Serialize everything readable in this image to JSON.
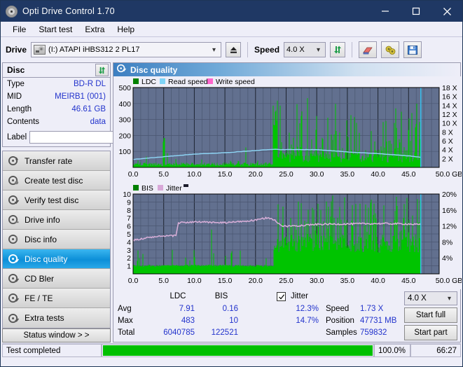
{
  "window": {
    "title": "Opti Drive Control 1.70",
    "icon": "disc-icon",
    "minimize": "minimize-icon",
    "maximize": "maximize-icon",
    "close": "close-icon"
  },
  "menu": {
    "items": [
      "File",
      "Start test",
      "Extra",
      "Help"
    ]
  },
  "toolbar": {
    "drive_label": "Drive",
    "drive_value": "(I:)   ATAPI iHBS312   2 PL17",
    "eject_icon": "eject-icon",
    "speed_label": "Speed",
    "speed_value": "4.0 X",
    "refresh_icon": "refresh-icon",
    "erase_icon": "erase-icon",
    "tools_icon": "tools-icon",
    "save_icon": "save-icon"
  },
  "disc": {
    "header": "Disc",
    "refresh_icon": "refresh-icon",
    "rows": [
      {
        "key": "Type",
        "value": "BD-R DL"
      },
      {
        "key": "MID",
        "value": "MEIRB1 (001)"
      },
      {
        "key": "Length",
        "value": "46.61 GB"
      },
      {
        "key": "Contents",
        "value": "data"
      }
    ],
    "label_key": "Label",
    "label_value": "",
    "label_btn_icon": "disc-label-icon"
  },
  "nav": {
    "items": [
      {
        "label": "Transfer rate",
        "icon": "disc-test-icon",
        "active": false
      },
      {
        "label": "Create test disc",
        "icon": "disc-create-icon",
        "active": false
      },
      {
        "label": "Verify test disc",
        "icon": "disc-verify-icon",
        "active": false
      },
      {
        "label": "Drive info",
        "icon": "drive-info-icon",
        "active": false
      },
      {
        "label": "Disc info",
        "icon": "disc-info-icon",
        "active": false
      },
      {
        "label": "Disc quality",
        "icon": "disc-quality-icon",
        "active": true
      },
      {
        "label": "CD Bler",
        "icon": "cd-bler-icon",
        "active": false
      },
      {
        "label": "FE / TE",
        "icon": "fe-te-icon",
        "active": false
      },
      {
        "label": "Extra tests",
        "icon": "extra-tests-icon",
        "active": false
      }
    ],
    "status_button": "Status window > >"
  },
  "main": {
    "title": "Disc quality",
    "title_icon": "disc-quality-icon"
  },
  "stats": {
    "col_ldc": "LDC",
    "col_bis": "BIS",
    "jitter_label": "Jitter",
    "jitter_checked": true,
    "rows": [
      {
        "label": "Avg",
        "ldc": "7.91",
        "bis": "0.16",
        "jitter": "12.3%"
      },
      {
        "label": "Max",
        "ldc": "483",
        "bis": "10",
        "jitter": "14.7%"
      },
      {
        "label": "Total",
        "ldc": "6040785",
        "bis": "122521",
        "jitter": ""
      }
    ],
    "speed_label": "Speed",
    "speed_value": "1.73 X",
    "position_label": "Position",
    "position_value": "47731 MB",
    "samples_label": "Samples",
    "samples_value": "759832",
    "speed_select": "4.0 X",
    "start_full": "Start full",
    "start_part": "Start part"
  },
  "statusbar": {
    "text": "Test completed",
    "percent_label": "100.0%",
    "percent": 100,
    "time": "66:27",
    "bar_color": "#00c000"
  },
  "chart_data": [
    {
      "type": "area",
      "name": "ldc-chart",
      "title": "",
      "xlabel": "GB",
      "ylabel": "",
      "xlim": [
        0,
        50
      ],
      "xticks": [
        "0.0",
        "5.0",
        "10.0",
        "15.0",
        "20.0",
        "25.0",
        "30.0",
        "35.0",
        "40.0",
        "45.0",
        "50.0 GB"
      ],
      "ylim": [
        0,
        500
      ],
      "yticks": [
        "100",
        "200",
        "300",
        "400",
        "500"
      ],
      "y2lim": [
        0,
        18
      ],
      "y2ticks": [
        "2 X",
        "4 X",
        "6 X",
        "8 X",
        "10 X",
        "12 X",
        "14 X",
        "16 X",
        "18 X"
      ],
      "grid": true,
      "plot_bg": "#62708f",
      "legend": [
        {
          "label": "LDC",
          "color": "#008000"
        },
        {
          "label": "Read speed",
          "color": "#7fd4f7"
        },
        {
          "label": "Write speed",
          "color": "#ff66cc"
        }
      ],
      "series": [
        {
          "name": "LDC",
          "color": "#00c000",
          "type": "bars",
          "note": "error counts per position; dense green spikes over 0-47 GB, baseline ~10-40, tall spikes to 200-480 after 23 GB",
          "x_end": 47.0
        },
        {
          "name": "Read speed",
          "color": "#8fd8f8",
          "type": "line",
          "note": "rises from ~1.8X at 0 GB to ~4.1X near 23 GB, flat ~4.1X to 30 GB, declines to ~2.3X at 47 GB",
          "points": [
            [
              0,
              1.8
            ],
            [
              5,
              2.4
            ],
            [
              10,
              3.0
            ],
            [
              15,
              3.3
            ],
            [
              20,
              3.8
            ],
            [
              23,
              4.1
            ],
            [
              24,
              4.0
            ],
            [
              30,
              4.0
            ],
            [
              35,
              3.5
            ],
            [
              40,
              3.1
            ],
            [
              45,
              2.6
            ],
            [
              47,
              2.3
            ]
          ]
        }
      ],
      "cursor_x": 47.0,
      "cursor_color": "#35c6f4"
    },
    {
      "type": "area",
      "name": "bis-jitter-chart",
      "title": "",
      "xlabel": "GB",
      "ylabel": "",
      "xlim": [
        0,
        50
      ],
      "xticks": [
        "0.0",
        "5.0",
        "10.0",
        "15.0",
        "20.0",
        "25.0",
        "30.0",
        "35.0",
        "40.0",
        "45.0",
        "50.0 GB"
      ],
      "ylim": [
        0,
        10
      ],
      "yticks": [
        "1",
        "2",
        "3",
        "4",
        "5",
        "6",
        "7",
        "8",
        "9",
        "10"
      ],
      "y2lim": [
        0,
        20
      ],
      "y2ticks": [
        "4%",
        "8%",
        "12%",
        "16%",
        "20%"
      ],
      "grid": true,
      "plot_bg": "#62708f",
      "legend": [
        {
          "label": "BIS",
          "color": "#008000"
        },
        {
          "label": "Jitter",
          "color": "#d8a8d8"
        }
      ],
      "series": [
        {
          "name": "BIS",
          "color": "#00c000",
          "type": "bars",
          "note": "baseline ~1, occasional spikes to 2-3 before 23 GB, dense spikes 2-10 after 23 GB",
          "x_end": 47.0
        },
        {
          "name": "Jitter",
          "color": "#d8a8d8",
          "type": "line",
          "note": "~8.4% rising to 9.7% until 7.3 GB, steps to ~12.8%, stays 12.5-14% to 23 GB, dips ~12%, then steady ~12.4% to 47 GB",
          "points": [
            [
              0,
              8.4
            ],
            [
              3,
              9.2
            ],
            [
              7,
              9.6
            ],
            [
              7.4,
              12.8
            ],
            [
              10,
              13.0
            ],
            [
              15,
              12.8
            ],
            [
              20,
              13.4
            ],
            [
              22,
              14.1
            ],
            [
              23,
              13.6
            ],
            [
              24,
              12.2
            ],
            [
              25,
              11.9
            ],
            [
              30,
              12.4
            ],
            [
              35,
              12.5
            ],
            [
              40,
              12.6
            ],
            [
              45,
              12.5
            ],
            [
              47,
              12.3
            ]
          ]
        }
      ],
      "cursor_x": 47.0,
      "cursor_color": "#35c6f4"
    }
  ]
}
